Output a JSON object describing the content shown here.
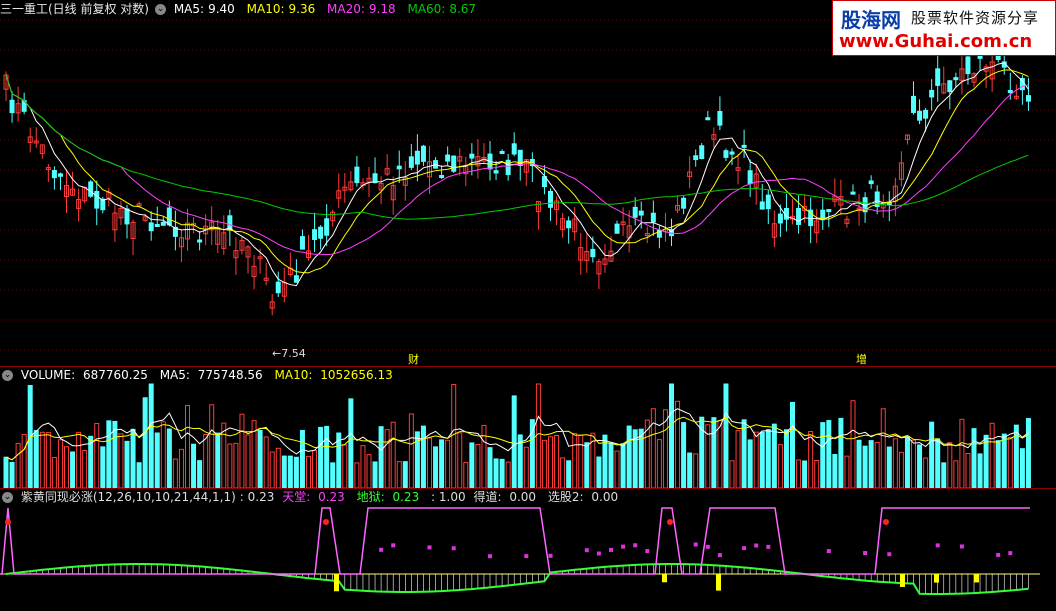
{
  "price_panel": {
    "title": "三一重工(日线 前复权 对数)",
    "collapse_icon": "circle-chevron-icon",
    "ma": [
      {
        "label": "MA5:",
        "value": "9.40",
        "color": "#ffffff"
      },
      {
        "label": "MA10:",
        "value": "9.36",
        "color": "#ffff00"
      },
      {
        "label": "MA20:",
        "value": "9.18",
        "color": "#ff40ff"
      },
      {
        "label": "MA60:",
        "value": "8.67",
        "color": "#00cc00"
      }
    ],
    "low_marker": "7.54",
    "event_marks": [
      "财",
      "增"
    ]
  },
  "volume_panel": {
    "label": "VOLUME:",
    "value": "687760.25",
    "ma5_label": "MA5:",
    "ma5": "775748.56",
    "ma10_label": "MA10:",
    "ma10": "1052656.13"
  },
  "indicator_panel": {
    "name": "紫黄同现必涨(12,26,10,10,21,44,1,1)",
    "v0": ": 0.23",
    "tiantang_label": "天堂:",
    "tiantang": "0.23",
    "diyu_label": "地狱:",
    "diyu": "0.23",
    "v3": ": 1.00",
    "dedao_label": "得道:",
    "dedao": "0.00",
    "xuangu_label": "选股2:",
    "xuangu": "0.00"
  },
  "watermark": {
    "brand": "股海网",
    "slogan": "股票软件资源分享",
    "url": "www.Guhai.com.cn"
  },
  "colors": {
    "up": "#ff3b3b",
    "down": "#54ffff",
    "ma5": "#ffffff",
    "ma10": "#ffff00",
    "ma20": "#ff40ff",
    "ma60": "#00cc00",
    "grid": "#8b0000"
  }
}
